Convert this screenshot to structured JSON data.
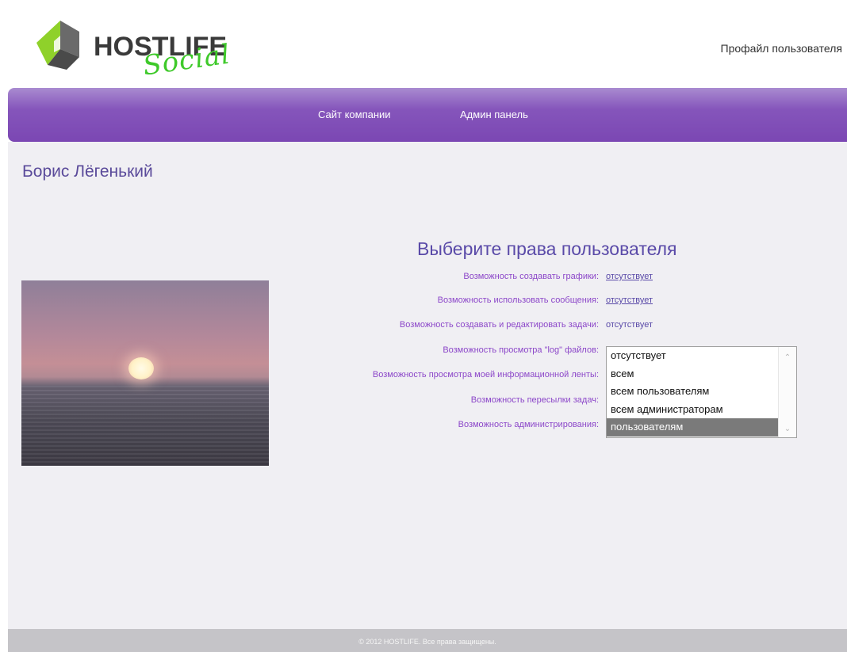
{
  "header": {
    "logo_text": "HOSTLIFE",
    "logo_social": "Social",
    "profile_link": "Профайл пользователя"
  },
  "nav": {
    "company_site": "Сайт компании",
    "admin_panel": "Админ панель"
  },
  "user": {
    "name": "Борис Лёгенький"
  },
  "rights": {
    "title": "Выберите права пользователя",
    "rows": [
      {
        "label": "Возможность создавать графики:",
        "value": "отсутствует"
      },
      {
        "label": "Возможность использовать сообщения:",
        "value": "отсутствует"
      },
      {
        "label": "Возможность создавать и редактировать задачи:",
        "value": "отсутствует"
      },
      {
        "label": "Возможность просмотра \"log\" файлов:"
      },
      {
        "label": "Возможность просмотра моей информационной ленты:"
      },
      {
        "label": "Возможность пересылки задач:"
      },
      {
        "label": "Возможность администрирования:"
      }
    ],
    "listbox_options": [
      "отсутствует",
      "всем",
      "всем пользователям",
      "всем администраторам",
      "пользователям"
    ],
    "listbox_selected": "пользователям"
  },
  "footer": {
    "text": "© 2012 HOSTLIFE. Все права защищены."
  },
  "colors": {
    "nav_purple": "#7b47b3",
    "label_purple": "#8c47c9",
    "title_blue": "#5a4aa8",
    "logo_green": "#3ec92a",
    "selected_gray": "#7a7a7a"
  }
}
